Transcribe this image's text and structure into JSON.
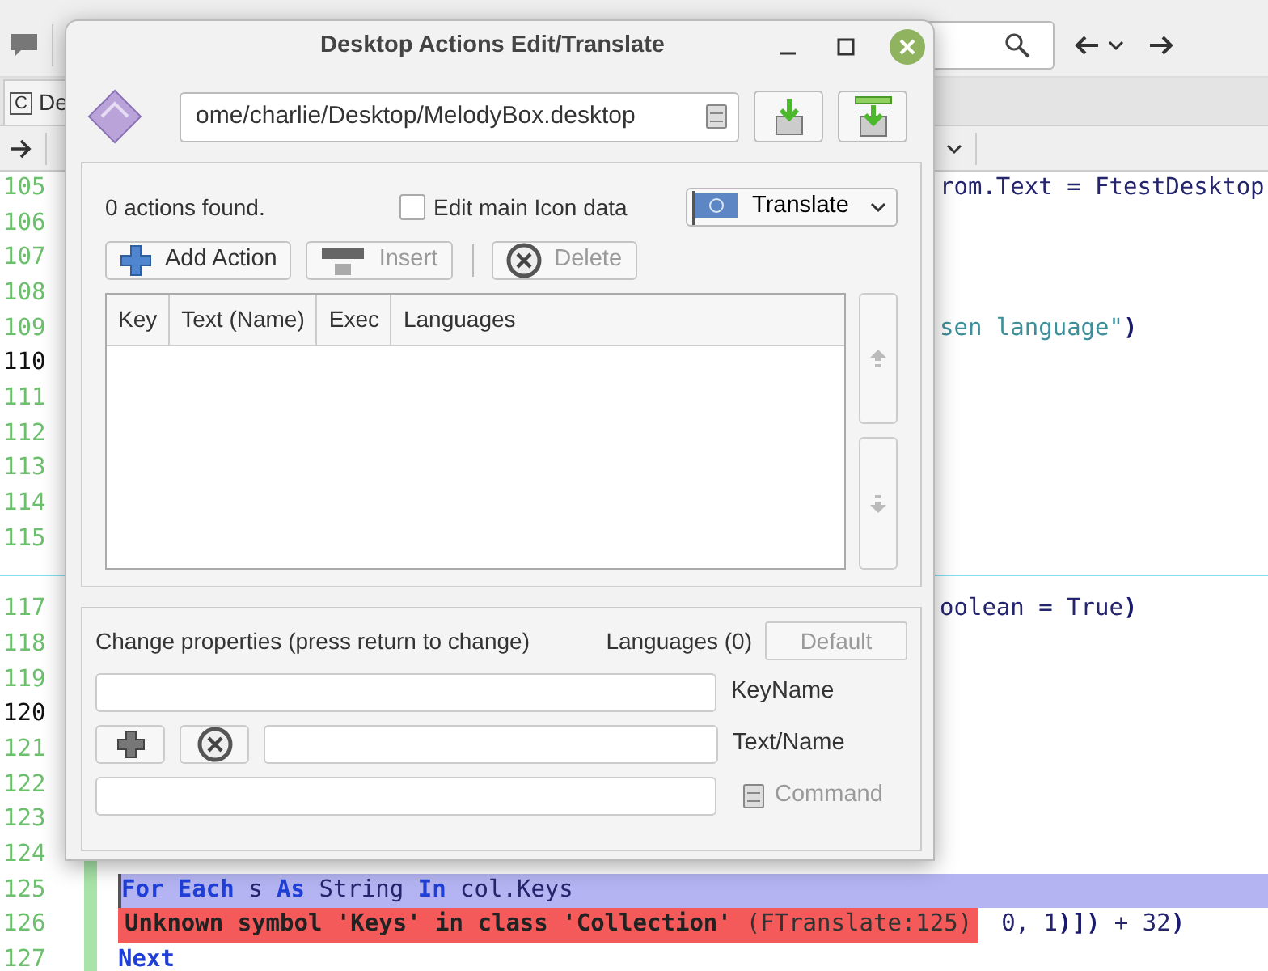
{
  "ide": {
    "tab": {
      "icon": "C",
      "label": "De"
    },
    "editor": {
      "lines": [
        {
          "kind": "line",
          "number": "105",
          "highlighted": false,
          "selected": false,
          "changed": false,
          "tail": [
            {
              "text": "rom.Text = FtestDesktop",
              "kind": "plain"
            }
          ]
        },
        {
          "kind": "line",
          "number": "106",
          "highlighted": false,
          "selected": false,
          "changed": false
        },
        {
          "kind": "line",
          "number": "107",
          "highlighted": false,
          "selected": false,
          "changed": false
        },
        {
          "kind": "line",
          "number": "108",
          "highlighted": false,
          "selected": false,
          "changed": false
        },
        {
          "kind": "line",
          "number": "109",
          "highlighted": false,
          "selected": false,
          "changed": false,
          "tail": [
            {
              "text": "sen language\"",
              "kind": "string"
            },
            {
              "text": ")",
              "kind": "paren"
            }
          ]
        },
        {
          "kind": "line",
          "number": "110",
          "highlighted": true,
          "selected": false,
          "changed": false
        },
        {
          "kind": "line",
          "number": "111",
          "highlighted": false,
          "selected": false,
          "changed": false
        },
        {
          "kind": "line",
          "number": "112",
          "highlighted": false,
          "selected": false,
          "changed": false
        },
        {
          "kind": "line",
          "number": "113",
          "highlighted": false,
          "selected": false,
          "changed": false
        },
        {
          "kind": "line",
          "number": "114",
          "highlighted": false,
          "selected": false,
          "changed": false
        },
        {
          "kind": "line",
          "number": "115",
          "highlighted": false,
          "selected": false,
          "changed": false
        },
        {
          "kind": "separator"
        },
        {
          "kind": "line",
          "number": "117",
          "highlighted": false,
          "selected": false,
          "changed": false,
          "tail": [
            {
              "text": "oolean = True",
              "kind": "plain"
            },
            {
              "text": ")",
              "kind": "paren"
            }
          ]
        },
        {
          "kind": "line",
          "number": "118",
          "highlighted": false,
          "selected": false,
          "changed": false
        },
        {
          "kind": "line",
          "number": "119",
          "highlighted": false,
          "selected": false,
          "changed": false
        },
        {
          "kind": "line",
          "number": "120",
          "highlighted": true,
          "selected": false,
          "changed": false
        },
        {
          "kind": "line",
          "number": "121",
          "highlighted": false,
          "selected": false,
          "changed": false
        },
        {
          "kind": "line",
          "number": "122",
          "highlighted": false,
          "selected": false,
          "changed": false
        },
        {
          "kind": "line",
          "number": "123",
          "highlighted": false,
          "selected": false,
          "changed": false
        },
        {
          "kind": "line",
          "number": "124",
          "highlighted": false,
          "selected": false,
          "changed": true
        },
        {
          "kind": "line",
          "number": "125",
          "highlighted": false,
          "selected": true,
          "changed": true,
          "code": [
            {
              "text": "For Each",
              "kind": "keyword"
            },
            {
              "text": " s ",
              "kind": "plain"
            },
            {
              "text": "As",
              "kind": "keyword"
            },
            {
              "text": " String ",
              "kind": "plain"
            },
            {
              "text": "In",
              "kind": "keyword"
            },
            {
              "text": " col.Keys",
              "kind": "plain"
            }
          ]
        },
        {
          "kind": "line",
          "number": "126",
          "highlighted": false,
          "selected": false,
          "changed": true,
          "error": {
            "message": "Unknown symbol 'Keys' in class 'Collection'",
            "location": "(FTranslate:125)"
          },
          "code": [
            {
              "text": "0, 1",
              "kind": "plain"
            },
            {
              "text": ")])",
              "kind": "paren"
            },
            {
              "text": " + 32",
              "kind": "plain"
            },
            {
              "text": ")",
              "kind": "paren"
            }
          ]
        },
        {
          "kind": "line",
          "number": "127",
          "highlighted": false,
          "selected": false,
          "changed": true,
          "code": [
            {
              "text": "Next",
              "kind": "keyword"
            }
          ]
        }
      ]
    }
  },
  "dialog": {
    "title": "Desktop Actions Edit/Translate",
    "file_path": "ome/charlie/Desktop/MelodyBox.desktop",
    "status": "0 actions found.",
    "edit_icon_checkbox": {
      "label": "Edit main Icon data",
      "checked": false
    },
    "translate_button": "Translate",
    "buttons": [
      {
        "kind": "plus",
        "label": "Add Action",
        "disabled": false
      },
      {
        "kind": "insert",
        "label": "Insert",
        "disabled": true
      },
      {
        "kind": "delete",
        "label": "Delete",
        "disabled": true
      }
    ],
    "table": {
      "columns": [
        "Key",
        "Text (Name)",
        "Exec",
        "Languages"
      ]
    },
    "move_buttons": [
      {
        "kind": "up",
        "disabled": true
      },
      {
        "kind": "down",
        "disabled": true
      }
    ],
    "properties": {
      "title": "Change properties (press return to change)",
      "languages": "Languages (0)",
      "default_button": {
        "label": "Default",
        "disabled": true
      },
      "fields": [
        {
          "kind": "plain",
          "label": "KeyName",
          "disabled": false
        },
        {
          "kind": "buttons",
          "label": "Text/Name",
          "disabled": false
        },
        {
          "kind": "file",
          "label": "Command",
          "disabled": true
        }
      ]
    }
  }
}
